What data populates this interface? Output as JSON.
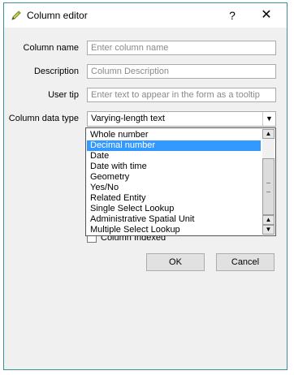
{
  "window": {
    "title": "Column editor",
    "help_label": "?",
    "close_label": "✕",
    "app_icon": "pencil-icon"
  },
  "form": {
    "column_name": {
      "label": "Column name",
      "placeholder": "Enter column name",
      "value": ""
    },
    "description": {
      "label": "Description",
      "placeholder": "Column Description",
      "value": ""
    },
    "user_tip": {
      "label": "User tip",
      "placeholder": "Enter text to appear in the form as a tooltip",
      "value": ""
    },
    "data_type": {
      "label": "Column data type",
      "value": "Varying-length text"
    }
  },
  "dropdown": {
    "items": [
      "Whole number",
      "Decimal number",
      "Date",
      "Date with time",
      "Geometry",
      "Yes/No",
      "Related Entity",
      "Single Select Lookup",
      "Administrative Spatial Unit",
      "Multiple Select Lookup"
    ],
    "selected": "Decimal number"
  },
  "checkbox": {
    "label": "Column Indexed",
    "checked": false
  },
  "buttons": {
    "ok": "OK",
    "cancel": "Cancel"
  },
  "colors": {
    "accent": "#3399ff",
    "border": "#3b8f9a"
  }
}
